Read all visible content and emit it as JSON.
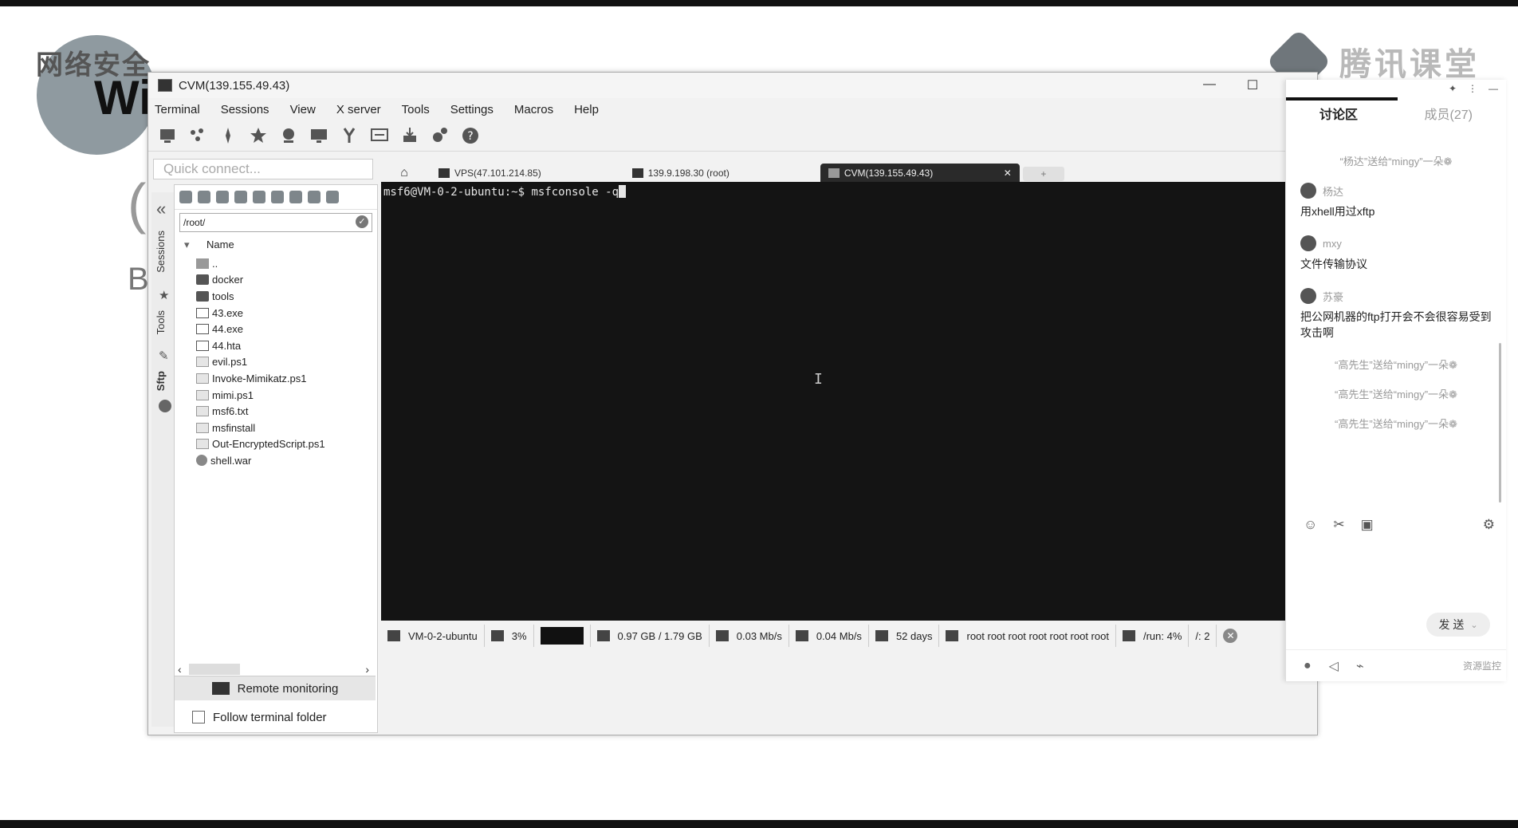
{
  "window": {
    "title": "CVM(139.155.49.43)",
    "controls": [
      "—",
      "☐",
      "✕"
    ]
  },
  "menu": [
    "Terminal",
    "Sessions",
    "View",
    "X server",
    "Tools",
    "Settings",
    "Macros",
    "Help"
  ],
  "toolbar_icons": [
    "session-icon",
    "servers-icon",
    "tools-icon",
    "star-icon",
    "xserver-icon",
    "monitor-icon",
    "split-icon",
    "multiexec-icon",
    "download-icon",
    "settings-icon",
    "help-icon"
  ],
  "quick_connect": {
    "placeholder": "Quick connect..."
  },
  "side_tabs": {
    "sessions": "Sessions",
    "tools": "Tools",
    "sftp": "Sftp"
  },
  "sftp": {
    "path": "/root/",
    "column_name": "Name",
    "files": [
      {
        "name": "..",
        "type": "up"
      },
      {
        "name": "docker",
        "type": "folder"
      },
      {
        "name": "tools",
        "type": "folder"
      },
      {
        "name": "43.exe",
        "type": "exe"
      },
      {
        "name": "44.exe",
        "type": "exe"
      },
      {
        "name": "44.hta",
        "type": "exe"
      },
      {
        "name": "evil.ps1",
        "type": "doc"
      },
      {
        "name": "Invoke-Mimikatz.ps1",
        "type": "doc"
      },
      {
        "name": "mimi.ps1",
        "type": "doc"
      },
      {
        "name": "msf6.txt",
        "type": "doc"
      },
      {
        "name": "msfinstall",
        "type": "doc"
      },
      {
        "name": "Out-EncryptedScript.ps1",
        "type": "doc"
      },
      {
        "name": "shell.war",
        "type": "war"
      }
    ],
    "remote_monitoring": "Remote monitoring",
    "follow_folder": "Follow terminal folder"
  },
  "tabs": [
    {
      "label": "VPS(47.101.214.85)"
    },
    {
      "label": "139.9.198.30 (root)"
    },
    {
      "label": "CVM(139.155.49.43)",
      "active": true
    }
  ],
  "terminal": {
    "prompt": "msf6@VM-0-2-ubuntu:~$ ",
    "command": "msfconsole -q"
  },
  "status": {
    "host": "VM-0-2-ubuntu",
    "cpu": "3%",
    "memory": "0.97 GB / 1.79 GB",
    "upload": "0.03 Mb/s",
    "download": "0.04 Mb/s",
    "uptime": "52 days",
    "users": "root root root root root root root",
    "disk": "/run: 4%",
    "disk2": "/: 2"
  },
  "background": {
    "slide_title": "网络安全",
    "slide_wi": "Wi",
    "brand": "腾讯课堂"
  },
  "chat": {
    "tab_discussion": "讨论区",
    "tab_members": "成员(27)",
    "messages": [
      {
        "kind": "system",
        "text": "“杨达”送给“mingy”一朵❁"
      },
      {
        "kind": "user",
        "user": "杨达",
        "text": "用xhell用过xftp"
      },
      {
        "kind": "user",
        "user": "mxy",
        "text": "文件传输协议"
      },
      {
        "kind": "user",
        "user": "苏豪",
        "text": "把公网机器的ftp打开会不会很容易受到攻击啊"
      },
      {
        "kind": "system",
        "text": "“高先生”送给“mingy”一朵❁"
      },
      {
        "kind": "system",
        "text": "“高先生”送给“mingy”一朵❁"
      },
      {
        "kind": "system",
        "text": "“高先生”送给“mingy”一朵❁"
      }
    ],
    "send_label": "发 送",
    "resource_label": "资源监控"
  }
}
